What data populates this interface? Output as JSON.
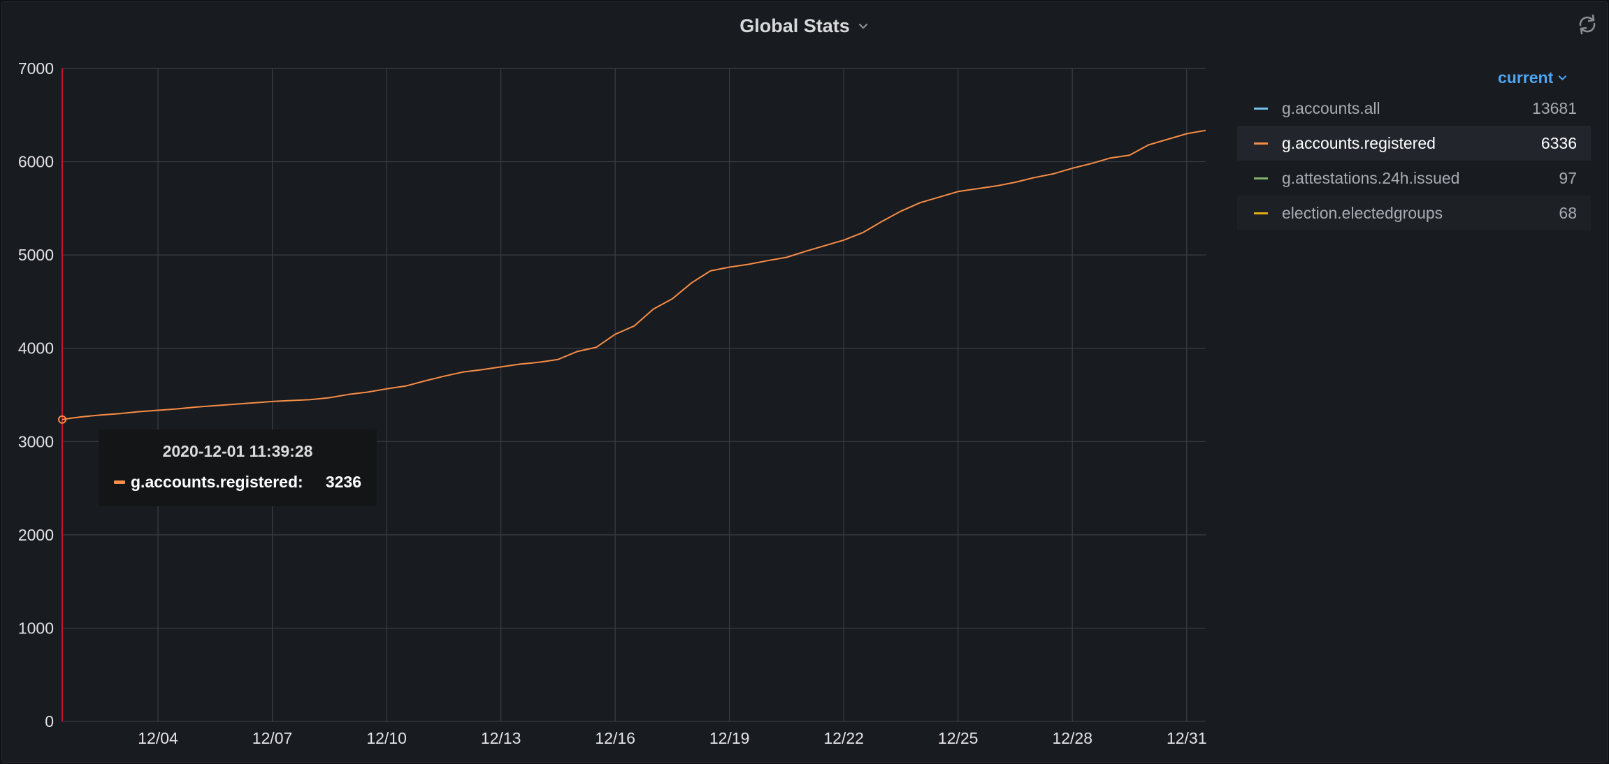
{
  "panel": {
    "title": "Global Stats",
    "icons": {
      "title_menu": "chevron-down-icon",
      "refresh": "refresh-icon"
    }
  },
  "legend": {
    "mode_label": "current",
    "items": [
      {
        "name": "g.accounts.all",
        "value": "13681",
        "color": "#73bfe9"
      },
      {
        "name": "g.accounts.registered",
        "value": "6336",
        "color": "#f78d47",
        "active": true
      },
      {
        "name": "g.attestations.24h.issued",
        "value": "97",
        "color": "#7eb26d"
      },
      {
        "name": "election.electedgroups",
        "value": "68",
        "color": "#e5ac0e"
      }
    ]
  },
  "tooltip": {
    "time": "2020-12-01 11:39:28",
    "series": "g.accounts.registered:",
    "value": "3236",
    "color": "#f78d47"
  },
  "colors": {
    "panel_bg": "#181b1f",
    "grid": "#3a3d44",
    "cursor_line": "#c4162a",
    "series_line": "#f78d47",
    "accent": "#4ea6f3"
  },
  "chart_data": {
    "type": "line",
    "x_unit": "date (December 2020)",
    "x_tick_labels": [
      "12/04",
      "12/07",
      "12/10",
      "12/13",
      "12/16",
      "12/19",
      "12/22",
      "12/25",
      "12/28",
      "12/31"
    ],
    "y_tick_labels": [
      "0",
      "1000",
      "2000",
      "3000",
      "4000",
      "5000",
      "6000",
      "7000"
    ],
    "xlim": [
      "2020-12-01T11:39",
      "2020-12-31T12:00"
    ],
    "ylim": [
      0,
      7000
    ],
    "grid": true,
    "legend_position": "right",
    "series": [
      {
        "name": "g.accounts.registered",
        "color": "#f78d47",
        "x": [
          "2020-12-01T11:39",
          "2020-12-01T17:00",
          "2020-12-02T00:00",
          "2020-12-02T12:00",
          "2020-12-03T00:00",
          "2020-12-03T12:00",
          "2020-12-04T00:00",
          "2020-12-04T12:00",
          "2020-12-05T00:00",
          "2020-12-05T12:00",
          "2020-12-06T00:00",
          "2020-12-06T12:00",
          "2020-12-07T00:00",
          "2020-12-07T12:00",
          "2020-12-08T00:00",
          "2020-12-08T12:00",
          "2020-12-09T00:00",
          "2020-12-09T12:00",
          "2020-12-10T00:00",
          "2020-12-10T12:00",
          "2020-12-11T00:00",
          "2020-12-11T12:00",
          "2020-12-12T00:00",
          "2020-12-12T12:00",
          "2020-12-13T00:00",
          "2020-12-13T12:00",
          "2020-12-14T00:00",
          "2020-12-14T12:00",
          "2020-12-15T00:00",
          "2020-12-15T12:00",
          "2020-12-16T00:00",
          "2020-12-16T12:00",
          "2020-12-17T00:00",
          "2020-12-17T12:00",
          "2020-12-18T00:00",
          "2020-12-18T12:00",
          "2020-12-19T00:00",
          "2020-12-19T12:00",
          "2020-12-20T00:00",
          "2020-12-20T12:00",
          "2020-12-21T00:00",
          "2020-12-21T12:00",
          "2020-12-22T00:00",
          "2020-12-22T12:00",
          "2020-12-23T00:00",
          "2020-12-23T12:00",
          "2020-12-24T00:00",
          "2020-12-24T12:00",
          "2020-12-25T00:00",
          "2020-12-25T12:00",
          "2020-12-26T00:00",
          "2020-12-26T12:00",
          "2020-12-27T00:00",
          "2020-12-27T12:00",
          "2020-12-28T00:00",
          "2020-12-28T12:00",
          "2020-12-29T00:00",
          "2020-12-29T12:00",
          "2020-12-30T00:00",
          "2020-12-30T12:00",
          "2020-12-31T00:00",
          "2020-12-31T12:00"
        ],
        "values": [
          3236,
          3250,
          3265,
          3285,
          3300,
          3320,
          3335,
          3350,
          3370,
          3385,
          3400,
          3415,
          3430,
          3440,
          3450,
          3470,
          3505,
          3530,
          3565,
          3595,
          3650,
          3700,
          3745,
          3770,
          3800,
          3830,
          3850,
          3880,
          3965,
          4010,
          4150,
          4240,
          4420,
          4530,
          4700,
          4830,
          4870,
          4900,
          4940,
          4975,
          5040,
          5100,
          5160,
          5240,
          5360,
          5470,
          5560,
          5620,
          5680,
          5710,
          5740,
          5780,
          5830,
          5870,
          5930,
          5980,
          6040,
          6070,
          6180,
          6240,
          6300,
          6336
        ]
      }
    ]
  }
}
